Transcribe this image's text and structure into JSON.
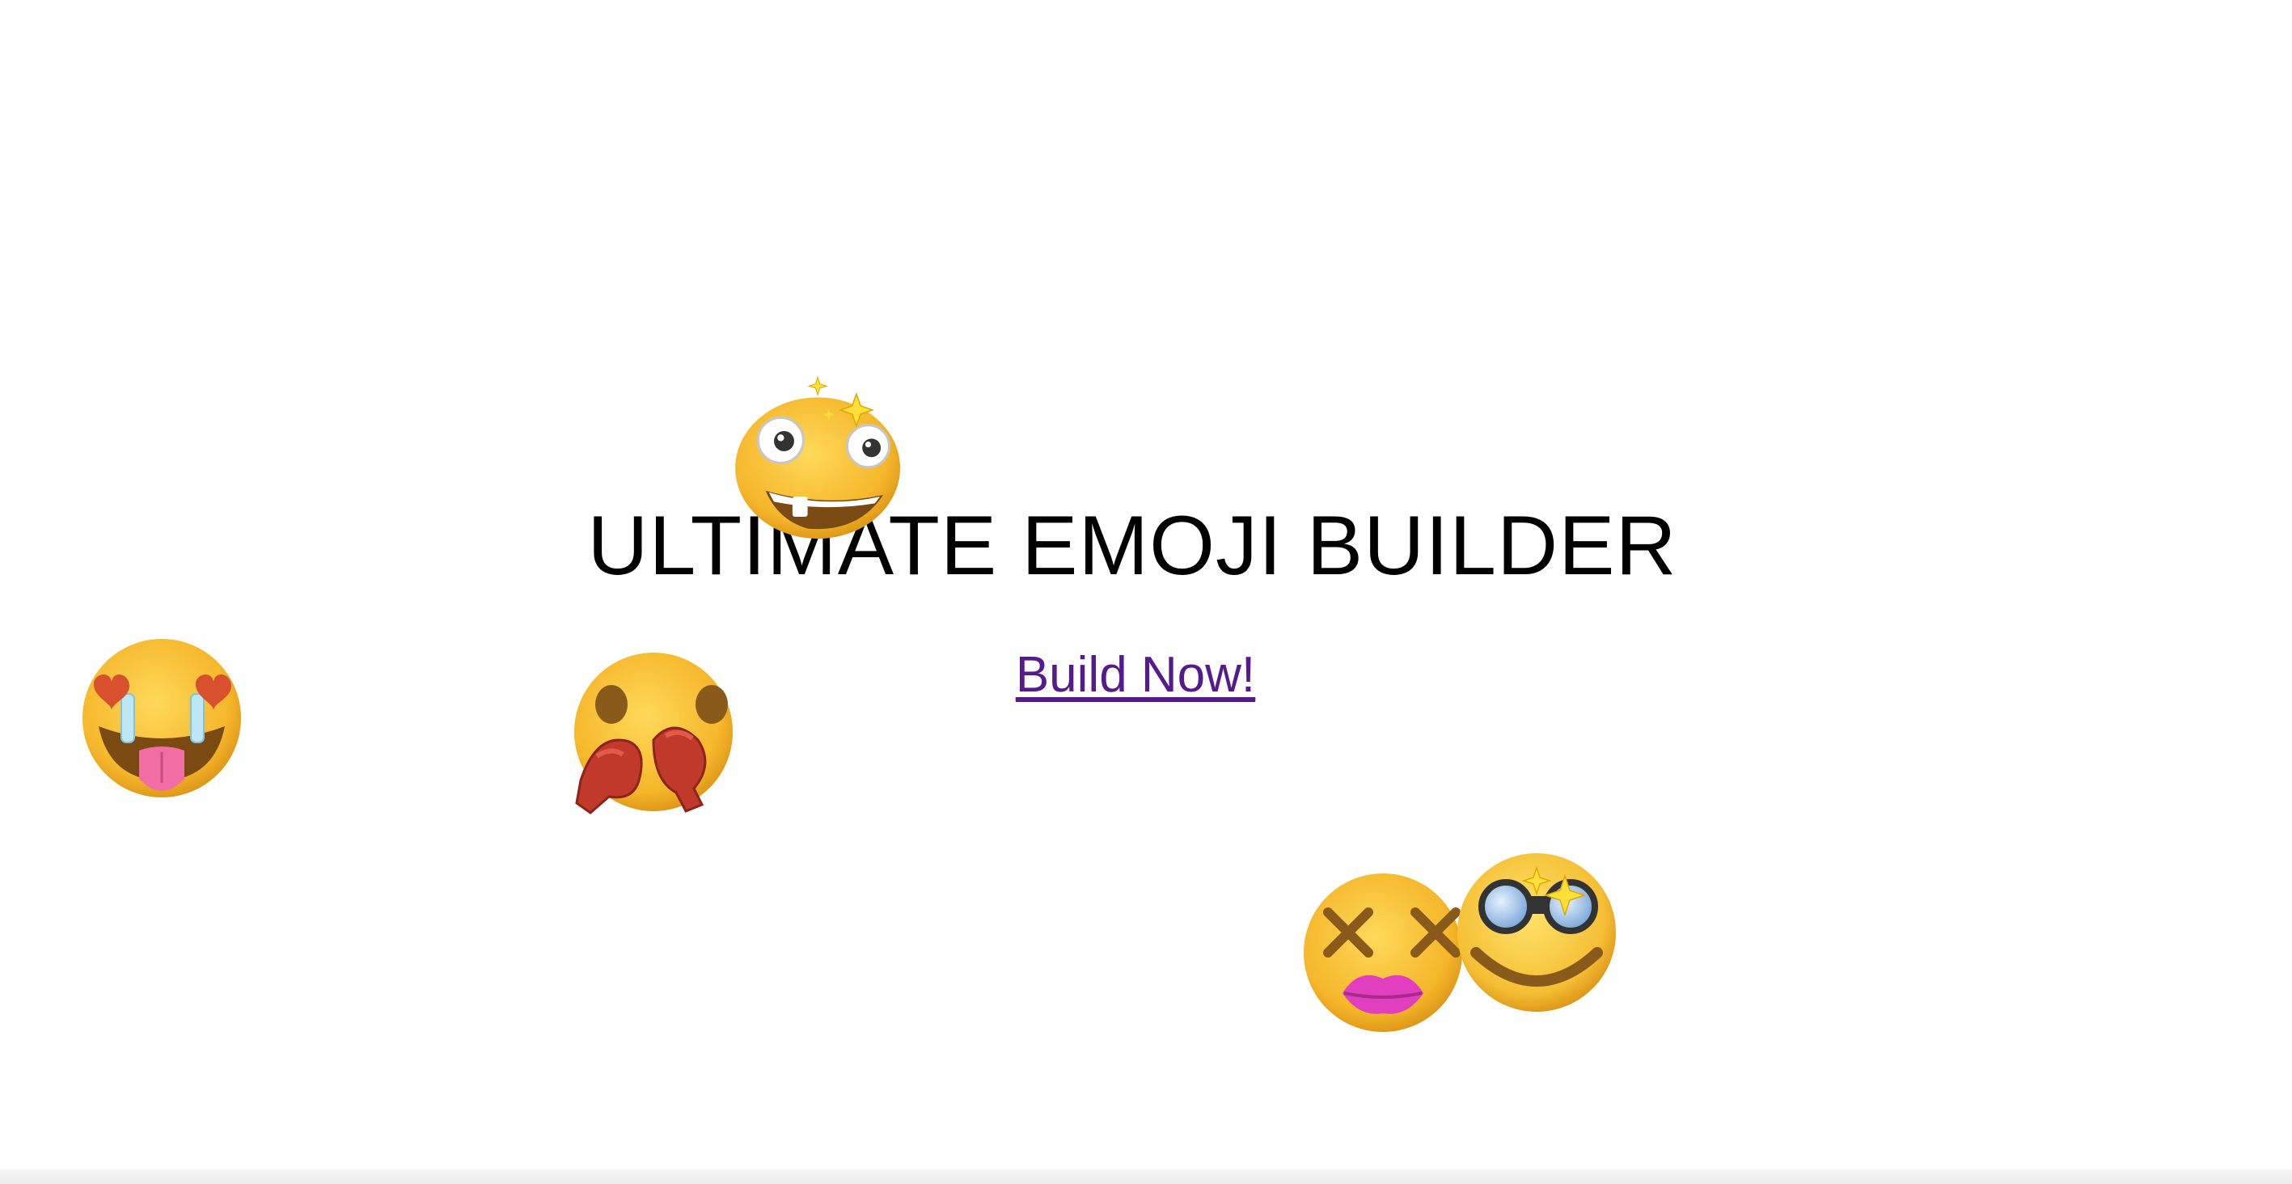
{
  "page": {
    "title": "ULTIMATE EMOJI BUILDER",
    "cta_label": "Build Now!",
    "link_color": "#551a8b",
    "background": "#ffffff"
  },
  "emojis": [
    {
      "name": "googly-eyes-sparkles-emoji"
    },
    {
      "name": "heart-eyes-tongue-tears-emoji"
    },
    {
      "name": "boxing-gloves-face-emoji"
    },
    {
      "name": "x-eyes-kiss-lips-emoji"
    },
    {
      "name": "binocular-eyes-smile-emoji"
    }
  ]
}
